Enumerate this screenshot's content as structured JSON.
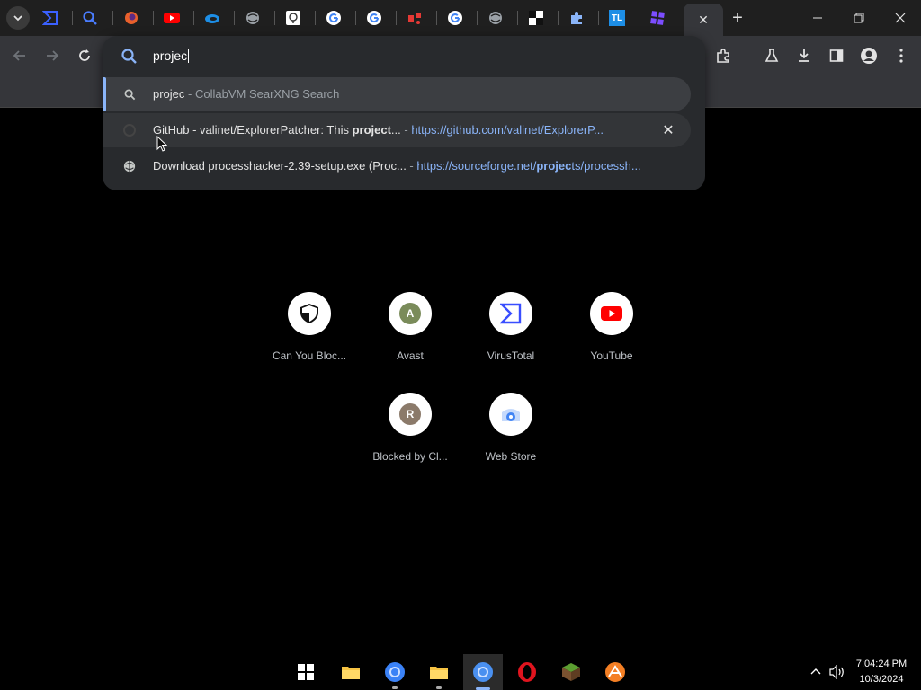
{
  "browser": {
    "tabs": [
      {
        "name": "virustotal-tab",
        "icon": "virustotal-icon"
      },
      {
        "name": "search-tab",
        "icon": "magnifier-icon"
      },
      {
        "name": "firefox-tab",
        "icon": "fox-icon"
      },
      {
        "name": "youtube-tab",
        "icon": "youtube-icon"
      },
      {
        "name": "edge-tab",
        "icon": "edge-icon"
      },
      {
        "name": "globe-tab",
        "icon": "globe-icon"
      },
      {
        "name": "cloud-tab",
        "icon": "cloud-icon"
      },
      {
        "name": "google-tab-1",
        "icon": "google-icon"
      },
      {
        "name": "google-tab-2",
        "icon": "google-icon"
      },
      {
        "name": "red-tab",
        "icon": "red-app-icon"
      },
      {
        "name": "google-tab-3",
        "icon": "google-icon"
      },
      {
        "name": "globe-tab-2",
        "icon": "globe-icon"
      },
      {
        "name": "shield-tab",
        "icon": "checker-icon"
      },
      {
        "name": "extensions-tab",
        "icon": "puzzle-icon"
      },
      {
        "name": "tl-tab",
        "icon": "tl-icon"
      },
      {
        "name": "purple-tab",
        "icon": "purple-grid-icon"
      }
    ],
    "tl_label": "TL",
    "active_tab_close": "✕",
    "new_tab": "+"
  },
  "omnibox": {
    "input_value": "projec",
    "suggestions": [
      {
        "type": "search",
        "term": "projec",
        "sep": " - ",
        "provider": "CollabVM SearXNG Search"
      },
      {
        "type": "history",
        "title_pre": "GitHub - valinet/ExplorerPatcher: This ",
        "title_bold": "project",
        "title_post": "...",
        "sep": " - ",
        "url": "https://github.com/valinet/ExplorerP..."
      },
      {
        "type": "history",
        "title_pre": "Download processhacker-2.39-setup.exe (Proc...",
        "sep": " - ",
        "url_pre": "https://sourceforge.net/",
        "url_bold": "projec",
        "url_post": "ts/processh..."
      }
    ],
    "remove_label": "✕"
  },
  "shortcuts": [
    {
      "label": "Can You Bloc...",
      "icon": "shield-icon"
    },
    {
      "label": "Avast",
      "letter": "A",
      "color": "#7a8b5a"
    },
    {
      "label": "VirusTotal",
      "icon": "virustotal-icon"
    },
    {
      "label": "YouTube",
      "icon": "youtube-icon"
    },
    {
      "label": "Blocked by Cl...",
      "letter": "R",
      "color": "#8b7a6a"
    },
    {
      "label": "Web Store",
      "icon": "webstore-icon"
    }
  ],
  "taskbar": {
    "time": "7:04:24 PM",
    "date": "10/3/2024"
  },
  "colors": {
    "accent": "#8ab4f8",
    "popup_bg": "#282a2d",
    "toolbar_bg": "#35363a"
  }
}
